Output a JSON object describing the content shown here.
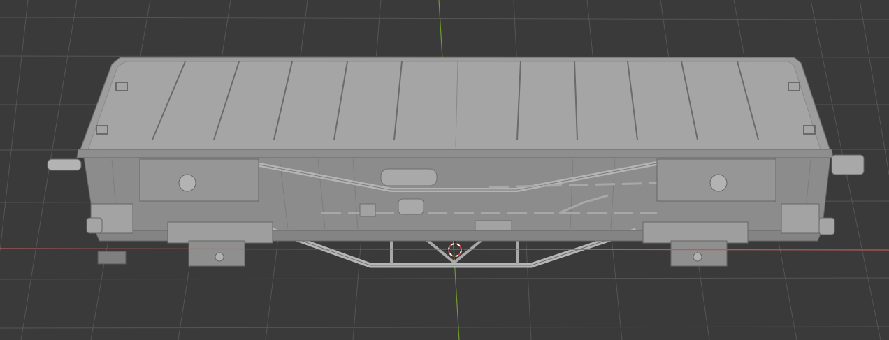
{
  "viewport": {
    "background": "#3a3a3a",
    "grid_color": "#545454",
    "x_axis_color": "#b85a5a",
    "y_axis_color": "#6f9a2c",
    "model_color": "#9c9c9c",
    "model_shadow_color": "#7a7a7a",
    "model_highlight_color": "#b4b4b4"
  },
  "scene": {
    "object": "freight-car-model",
    "cursor_icon": "3d-cursor-icon"
  }
}
